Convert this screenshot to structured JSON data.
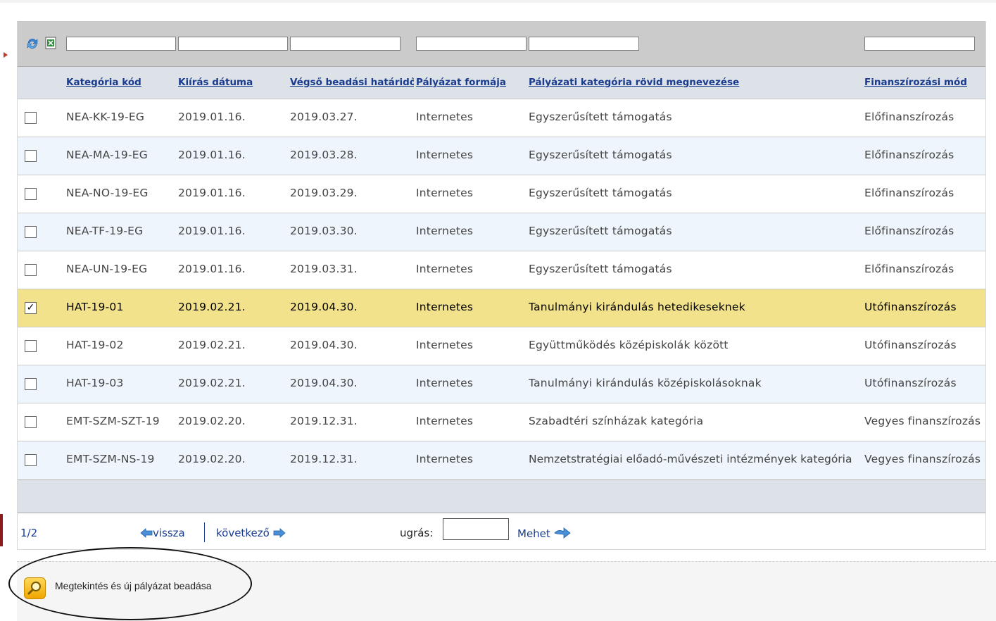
{
  "filters": [
    {
      "name": "filter-kategoria-kod",
      "value": ""
    },
    {
      "name": "filter-kiiras-datuma",
      "value": ""
    },
    {
      "name": "filter-vegso-hatarido",
      "value": ""
    },
    {
      "name": "filter-rovid-megnevezes-1",
      "value": ""
    },
    {
      "name": "filter-rovid-megnevezes-2",
      "value": ""
    },
    {
      "name": "filter-finanszirozasi-mod",
      "value": ""
    }
  ],
  "columns": [
    "Kategória kód",
    "Kiírás dátuma",
    "Végső beadási határidő",
    "Pályázat formája",
    "Pályázati kategória rövid megnevezése",
    "Finanszírozási mód"
  ],
  "rows": [
    {
      "checked": false,
      "code": "NEA-KK-19-EG",
      "issued": "2019.01.16.",
      "deadline": "2019.03.27.",
      "form": "Internetes",
      "name": "Egyszerűsített támogatás",
      "financing": "Előfinanszírozás"
    },
    {
      "checked": false,
      "code": "NEA-MA-19-EG",
      "issued": "2019.01.16.",
      "deadline": "2019.03.28.",
      "form": "Internetes",
      "name": "Egyszerűsített támogatás",
      "financing": "Előfinanszírozás"
    },
    {
      "checked": false,
      "code": "NEA-NO-19-EG",
      "issued": "2019.01.16.",
      "deadline": "2019.03.29.",
      "form": "Internetes",
      "name": "Egyszerűsített támogatás",
      "financing": "Előfinanszírozás"
    },
    {
      "checked": false,
      "code": "NEA-TF-19-EG",
      "issued": "2019.01.16.",
      "deadline": "2019.03.30.",
      "form": "Internetes",
      "name": "Egyszerűsített támogatás",
      "financing": "Előfinanszírozás"
    },
    {
      "checked": false,
      "code": "NEA-UN-19-EG",
      "issued": "2019.01.16.",
      "deadline": "2019.03.31.",
      "form": "Internetes",
      "name": "Egyszerűsített támogatás",
      "financing": "Előfinanszírozás"
    },
    {
      "checked": true,
      "code": "HAT-19-01",
      "issued": "2019.02.21.",
      "deadline": "2019.04.30.",
      "form": "Internetes",
      "name": "Tanulmányi kirándulás hetedikeseknek",
      "financing": "Utófinanszírozás"
    },
    {
      "checked": false,
      "code": "HAT-19-02",
      "issued": "2019.02.21.",
      "deadline": "2019.04.30.",
      "form": "Internetes",
      "name": "Együttműködés középiskolák között",
      "financing": "Utófinanszírozás"
    },
    {
      "checked": false,
      "code": "HAT-19-03",
      "issued": "2019.02.21.",
      "deadline": "2019.04.30.",
      "form": "Internetes",
      "name": "Tanulmányi kirándulás középiskolásoknak",
      "financing": "Utófinanszírozás"
    },
    {
      "checked": false,
      "code": "EMT-SZM-SZT-19",
      "issued": "2019.02.20.",
      "deadline": "2019.12.31.",
      "form": "Internetes",
      "name": "Szabadtéri színházak kategória",
      "financing": "Vegyes finanszírozás"
    },
    {
      "checked": false,
      "code": "EMT-SZM-NS-19",
      "issued": "2019.02.20.",
      "deadline": "2019.12.31.",
      "form": "Internetes",
      "name": "Nemzetstratégiai előadó-művészeti intézmények kategória",
      "financing": "Vegyes finanszírozás"
    }
  ],
  "pager": {
    "page": "1/2",
    "back_label": "vissza",
    "next_label": "következő",
    "jump_label": "ugrás:",
    "jump_value": "",
    "go_label": "Mehet"
  },
  "action": {
    "label": "Megtekintés és új pályázat beadása",
    "icon": "magnifier-icon"
  },
  "colors": {
    "header_bg": "#dde2e8",
    "link": "#1a3c8f",
    "selected_row": "#f3e28c",
    "alt_row": "#eef5fc"
  }
}
